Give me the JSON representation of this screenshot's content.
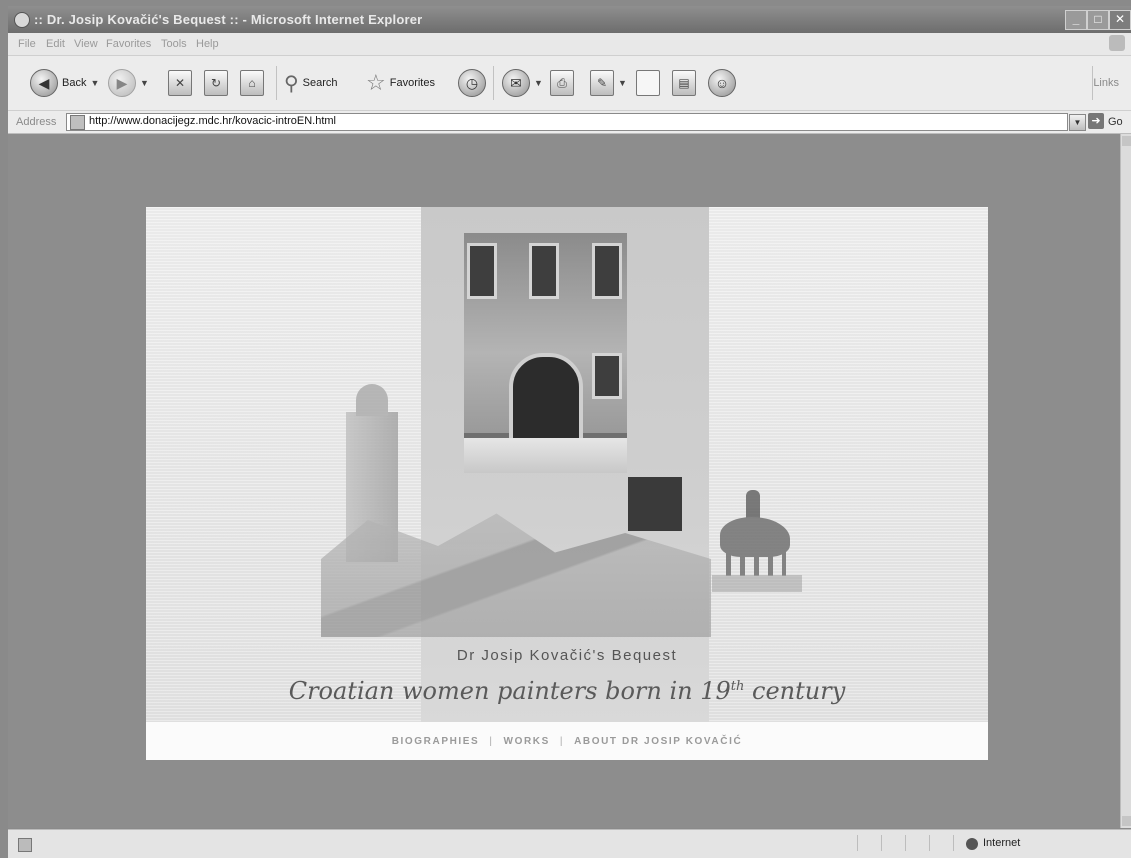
{
  "window": {
    "title": ":: Dr. Josip Kovačić's Bequest :: - Microsoft Internet Explorer",
    "controls": {
      "minimize": "_",
      "maximize": "□",
      "close": "✕"
    }
  },
  "menu": [
    "File",
    "Edit",
    "View",
    "Favorites",
    "Tools",
    "Help"
  ],
  "toolbar": {
    "back_label": "Back",
    "search_label": "Search",
    "favorites_label": "Favorites",
    "links_label": "Links"
  },
  "address": {
    "label": "Address",
    "url": "http://www.donacijegz.mdc.hr/kovacic-introEN.html",
    "go_label": "Go"
  },
  "site": {
    "bequest_title": "Dr Josip Kovačić's Bequest",
    "tagline_main": "Croatian women painters born in 19",
    "tagline_sup": "th",
    "tagline_end": " century",
    "nav": {
      "biographies": "BIOGRAPHIES",
      "works": "WORKS",
      "about": "ABOUT DR JOSIP KOVAČIĆ",
      "separator": "|"
    }
  },
  "status": {
    "zone": "Internet"
  }
}
